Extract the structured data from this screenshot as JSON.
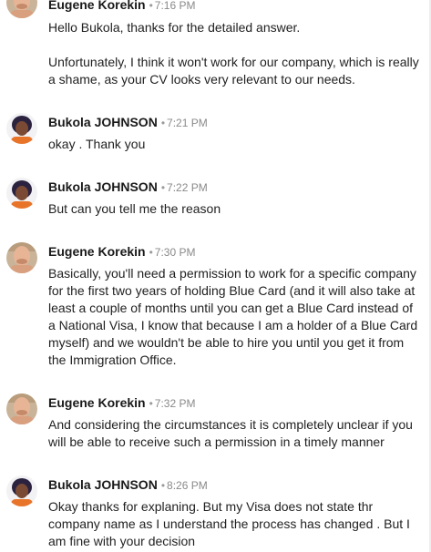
{
  "messages": [
    {
      "sender": "Eugene Korekin",
      "separator": "•",
      "time": "7:16 PM",
      "paragraphs": [
        "Hello Bukola, thanks for the detailed answer.",
        "Unfortunately, I think it won't work for our company, which is really a shame, as your CV looks very relevant to our needs."
      ]
    },
    {
      "sender": "Bukola JOHNSON",
      "separator": "•",
      "time": "7:21 PM",
      "paragraphs": [
        "okay . Thank you"
      ]
    },
    {
      "sender": "Bukola JOHNSON",
      "separator": "•",
      "time": "7:22 PM",
      "paragraphs": [
        "But can you tell me the reason"
      ]
    },
    {
      "sender": "Eugene Korekin",
      "separator": "•",
      "time": "7:30 PM",
      "paragraphs": [
        "Basically, you'll need a permission to work for a specific company for the first two years of holding Blue Card (and it will also take at least a couple of months until you can get a Blue Card instead of a National Visa, I know that because I am a holder of a Blue Card myself) and we wouldn't be able to hire you until you get it from the Immigration Office."
      ]
    },
    {
      "sender": "Eugene Korekin",
      "separator": "•",
      "time": "7:32 PM",
      "paragraphs": [
        "And considering the circumstances it is completely unclear if you will be able to receive such a permission in a timely manner"
      ]
    },
    {
      "sender": "Bukola JOHNSON",
      "separator": "•",
      "time": "8:26 PM",
      "paragraphs": [
        "Okay thanks for explaning. But my Visa does not state thr company name as I understand the process has changed . But I am fine with your decision"
      ]
    }
  ]
}
